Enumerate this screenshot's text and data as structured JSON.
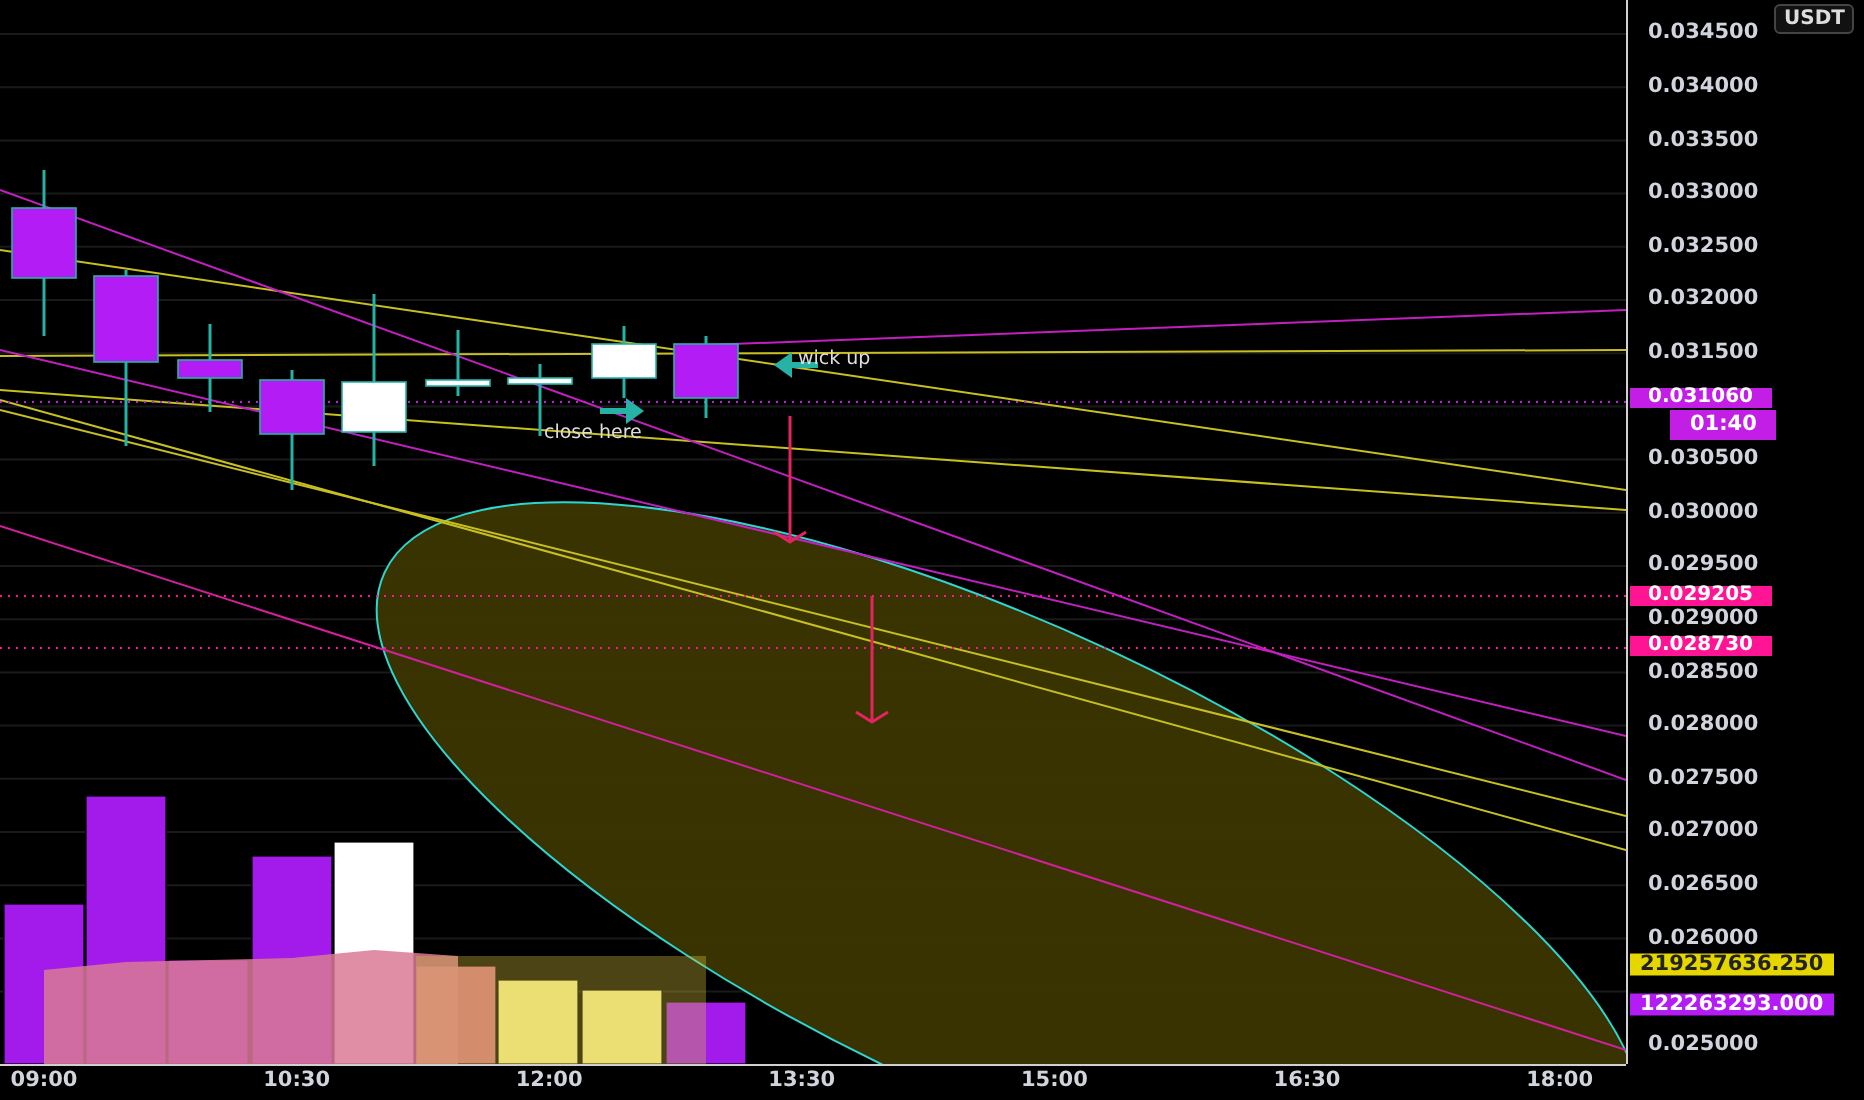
{
  "currency_badge": "USDT",
  "price_axis": {
    "ticks": [
      "0.034500",
      "0.034000",
      "0.033500",
      "0.033000",
      "0.032500",
      "0.032000",
      "0.031500",
      "0.030500",
      "0.030000",
      "0.029500",
      "0.029000",
      "0.028500",
      "0.028000",
      "0.027500",
      "0.027000",
      "0.026500",
      "0.026000",
      "0.025000"
    ]
  },
  "price_labels": [
    {
      "text": "0.031060",
      "color": "#c21ee6",
      "countdown": "01:40"
    },
    {
      "text": "0.029205",
      "color": "#ff1493"
    },
    {
      "text": "0.028730",
      "color": "#ff1493"
    }
  ],
  "volume_labels": [
    {
      "text": "219257636.250",
      "color": "#e6d600"
    },
    {
      "text": "122263293.000",
      "color": "#b41cf5"
    }
  ],
  "time_axis": {
    "labels": [
      "09:00",
      "10:30",
      "12:00",
      "13:30",
      "15:00",
      "16:30",
      "18:00"
    ]
  },
  "annotations": [
    {
      "text": "wick up"
    },
    {
      "text": "close here"
    }
  ]
}
